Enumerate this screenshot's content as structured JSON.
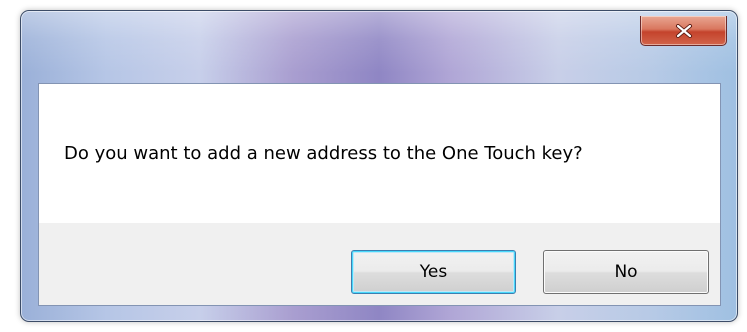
{
  "dialog": {
    "close_glyph": "x",
    "message": "Do you want to add a new address to the One Touch key?",
    "buttons": {
      "yes_label": "Yes",
      "no_label": "No",
      "default": "Yes"
    }
  },
  "colors": {
    "close_button": "#c4432c",
    "default_button_border": "#3c7fb1",
    "button_area": "#f0f0f0",
    "frame_accent": "#8f86c4"
  },
  "icons": {
    "close": "close-icon"
  }
}
